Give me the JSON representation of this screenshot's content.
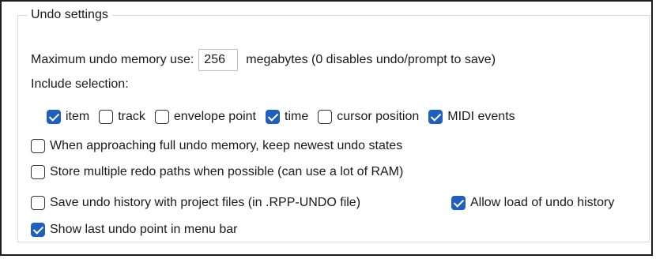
{
  "group": {
    "title": "Undo settings"
  },
  "memory": {
    "label": "Maximum undo memory use:",
    "value": "256",
    "suffix": "megabytes (0 disables undo/prompt to save)"
  },
  "selection": {
    "label": "Include selection:",
    "items": [
      {
        "label": "item",
        "checked": true
      },
      {
        "label": "track",
        "checked": false
      },
      {
        "label": "envelope point",
        "checked": false
      },
      {
        "label": "time",
        "checked": true
      },
      {
        "label": "cursor position",
        "checked": false
      },
      {
        "label": "MIDI events",
        "checked": true
      }
    ]
  },
  "options": {
    "keep_newest": {
      "label": "When approaching full undo memory, keep newest undo states",
      "checked": false
    },
    "multiple_redo": {
      "label": "Store multiple redo paths when possible (can use a lot of RAM)",
      "checked": false
    },
    "save_history": {
      "label": "Save undo history with project files (in .RPP-UNDO file)",
      "checked": false
    },
    "allow_load": {
      "label": "Allow load of undo history",
      "checked": true
    },
    "show_last": {
      "label": "Show last undo point in menu bar",
      "checked": true
    }
  },
  "colors": {
    "accent": "#1e5fbf",
    "border": "#d9d9d9"
  }
}
